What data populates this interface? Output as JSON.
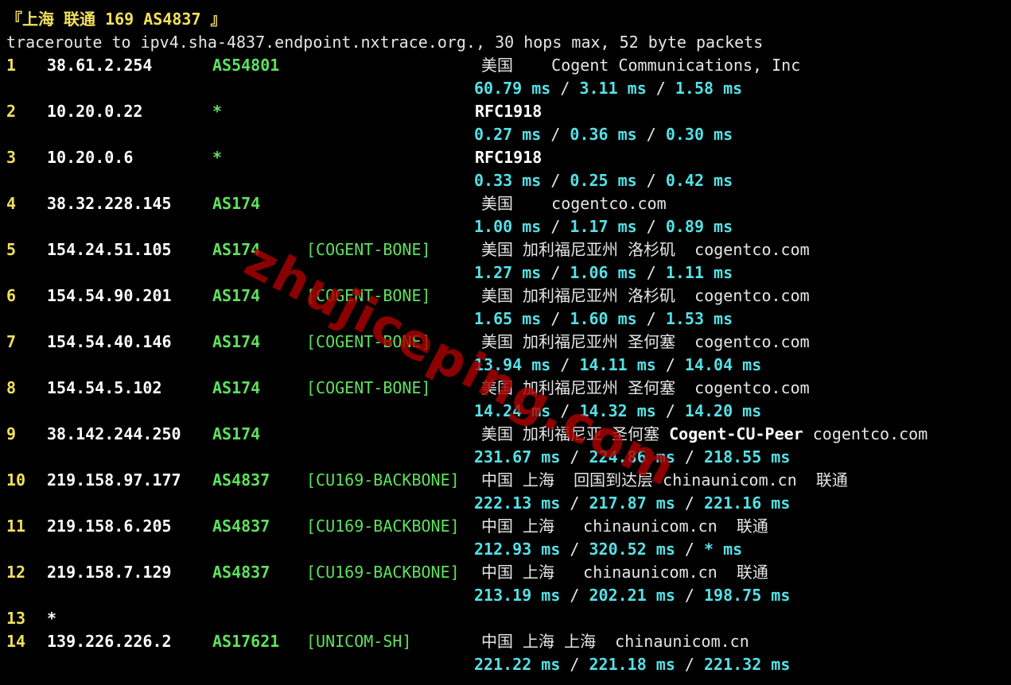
{
  "terminal": {
    "title": "『上海 联通 169 AS4837 』",
    "command_line": "traceroute to ipv4.sha-4837.endpoint.nxtrace.org., 30 hops max, 52 byte packets",
    "watermark": "zhujiceping.com"
  },
  "hops": [
    {
      "hop": "1",
      "ip": "38.61.2.254",
      "asn": "AS54801",
      "tag": "",
      "geo": "美国    Cogent Communications, Inc",
      "rtt": [
        "60.79 ms",
        "3.11 ms",
        "1.58 ms"
      ]
    },
    {
      "hop": "2",
      "ip": "10.20.0.22",
      "asn": "*",
      "tag": "",
      "geo": "RFC1918",
      "rtt": [
        "0.27 ms",
        "0.36 ms",
        "0.30 ms"
      ]
    },
    {
      "hop": "3",
      "ip": "10.20.0.6",
      "asn": "*",
      "tag": "",
      "geo": "RFC1918",
      "rtt": [
        "0.33 ms",
        "0.25 ms",
        "0.42 ms"
      ]
    },
    {
      "hop": "4",
      "ip": "38.32.228.145",
      "asn": "AS174",
      "tag": "",
      "geo": "美国    cogentco.com",
      "rtt": [
        "1.00 ms",
        "1.17 ms",
        "0.89 ms"
      ]
    },
    {
      "hop": "5",
      "ip": "154.24.51.105",
      "asn": "AS174",
      "tag": "[COGENT-BONE]",
      "geo": "美国 加利福尼亚州 洛杉矶  cogentco.com",
      "rtt": [
        "1.27 ms",
        "1.06 ms",
        "1.11 ms"
      ]
    },
    {
      "hop": "6",
      "ip": "154.54.90.201",
      "asn": "AS174",
      "tag": "[COGENT-BONE]",
      "geo": "美国 加利福尼亚州 洛杉矶  cogentco.com",
      "rtt": [
        "1.65 ms",
        "1.60 ms",
        "1.53 ms"
      ]
    },
    {
      "hop": "7",
      "ip": "154.54.40.146",
      "asn": "AS174",
      "tag": "[COGENT-BONE]",
      "geo": "美国 加利福尼亚州 圣何塞  cogentco.com",
      "rtt": [
        "13.94 ms",
        "14.11 ms",
        "14.04 ms"
      ]
    },
    {
      "hop": "8",
      "ip": "154.54.5.102",
      "asn": "AS174",
      "tag": "[COGENT-BONE]",
      "geo": "美国 加利福尼亚州 圣何塞  cogentco.com",
      "rtt": [
        "14.24 ms",
        "14.32 ms",
        "14.20 ms"
      ]
    },
    {
      "hop": "9",
      "ip": "38.142.244.250",
      "asn": "AS174",
      "tag": "",
      "geo": "美国 加利福尼亚 圣何塞 ",
      "geo_bold": "Cogent-CU-Peer",
      "geo_tail": " cogentco.com",
      "rtt": [
        "231.67 ms",
        "224.86 ms",
        "218.55 ms"
      ]
    },
    {
      "hop": "10",
      "ip": "219.158.97.177",
      "asn": "AS4837",
      "tag": "[CU169-BACKBONE]",
      "geo": "中国 上海  回国到达层 chinaunicom.cn  联通",
      "rtt": [
        "222.13 ms",
        "217.87 ms",
        "221.16 ms"
      ]
    },
    {
      "hop": "11",
      "ip": "219.158.6.205",
      "asn": "AS4837",
      "tag": "[CU169-BACKBONE]",
      "geo": "中国 上海   chinaunicom.cn  联通",
      "rtt": [
        "212.93 ms",
        "320.52 ms",
        "* ms"
      ]
    },
    {
      "hop": "12",
      "ip": "219.158.7.129",
      "asn": "AS4837",
      "tag": "[CU169-BACKBONE]",
      "geo": "中国 上海   chinaunicom.cn  联通",
      "rtt": [
        "213.19 ms",
        "202.21 ms",
        "198.75 ms"
      ]
    },
    {
      "hop": "13",
      "ip": "*",
      "asn": "",
      "tag": "",
      "geo": "",
      "rtt": []
    },
    {
      "hop": "14",
      "ip": "139.226.226.2",
      "asn": "AS17621",
      "tag": "[UNICOM-SH]",
      "geo": "中国 上海 上海  chinaunicom.cn",
      "rtt": [
        "221.22 ms",
        "221.18 ms",
        "221.32 ms"
      ]
    }
  ]
}
